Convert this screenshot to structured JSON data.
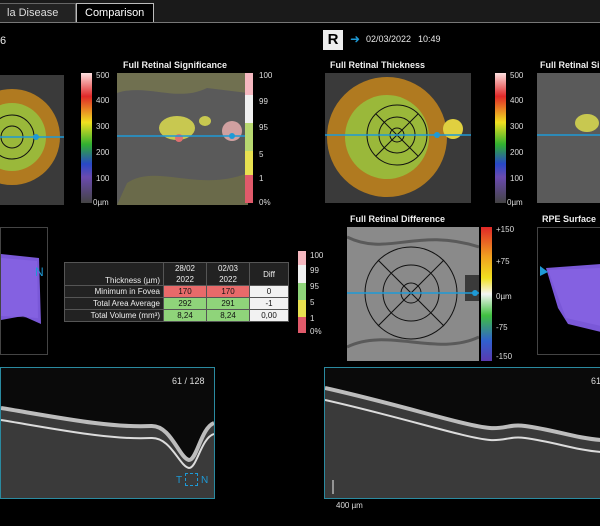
{
  "tabs": [
    {
      "label": "la Disease",
      "active": false
    },
    {
      "label": "Comparison",
      "active": true
    }
  ],
  "left_header": {
    "eye_fragment": "6"
  },
  "right_header": {
    "eye": "R",
    "date": "02/03/2022",
    "time": "10:49"
  },
  "panels": {
    "full_retinal_significance": "Full Retinal Significance",
    "full_retinal_thickness": "Full Retinal Thickness",
    "full_retinal_significance_right": "Full Retinal Si",
    "full_retinal_difference": "Full Retinal Difference",
    "rpe_surface": "RPE Surface"
  },
  "thickness_scale": [
    "500",
    "400",
    "300",
    "200",
    "100",
    "0µm"
  ],
  "significance_scale": [
    "100",
    "99",
    "95",
    "5",
    "1",
    "0%"
  ],
  "difference_scale": [
    "+150",
    "+75",
    "0µm",
    "-75",
    "-150"
  ],
  "table": {
    "header_label": "Thickness (µm)",
    "col1": {
      "top": "28/02",
      "bottom": "2022"
    },
    "col2": {
      "top": "02/03",
      "bottom": "2022"
    },
    "col3": "Diff",
    "rows": [
      {
        "label": "Minimum in Fovea",
        "v1": "170",
        "v2": "170",
        "diff": "0"
      },
      {
        "label": "Total Area Average",
        "v1": "292",
        "v2": "291",
        "diff": "-1"
      },
      {
        "label": "Total Volume (mm³)",
        "v1": "8,24",
        "v2": "8,24",
        "diff": "0,00"
      }
    ]
  },
  "scan": {
    "counter_left": "61 / 128",
    "counter_right": "61",
    "scale_bar": "400 µm",
    "t_label": "T",
    "n_label": "N"
  },
  "side_letter_n": "N",
  "colors": {
    "accent": "#1e9ad6",
    "red_cell": "#e86a6a",
    "green_cell": "#8fd47a"
  }
}
